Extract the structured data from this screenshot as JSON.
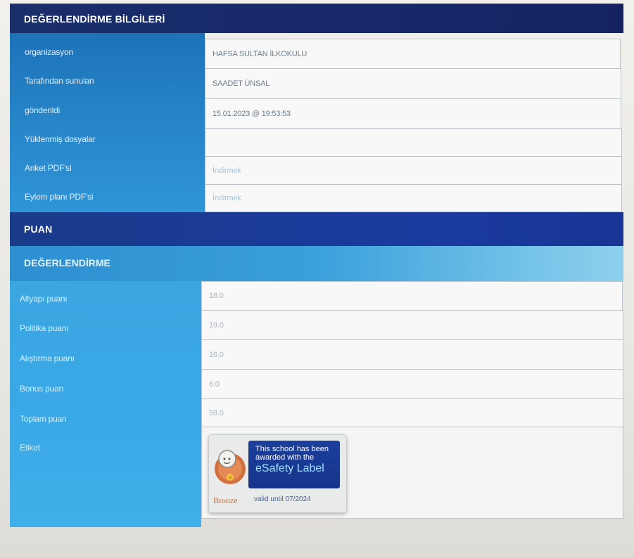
{
  "sections": {
    "info_title": "DEĞERLENDİRME BİLGİLERİ",
    "score_title": "PUAN",
    "eval_title": "DEĞERLENDİRME"
  },
  "info_rows": [
    {
      "label": "organizasyon",
      "value": "HAFSA SULTAN İLKOKULU"
    },
    {
      "label": "Tarafından sunulan",
      "value": "SAADET ÜNSAL"
    },
    {
      "label": "gönderildi",
      "value": "15.01.2023 @ 19:53:53"
    },
    {
      "label": "Yüklenmiş dosyalar",
      "value": ""
    },
    {
      "label": "Anket PDF'si",
      "value": "İndirmek"
    },
    {
      "label": "Eylem planı PDF'si",
      "value": "İndirmek"
    }
  ],
  "score_rows": [
    {
      "label": "Altyapı puanı",
      "value": "18.0"
    },
    {
      "label": "Politika puanı",
      "value": "19.0"
    },
    {
      "label": "Alıştırma puanı",
      "value": "16.0"
    },
    {
      "label": "Bonus puan",
      "value": "6.0"
    },
    {
      "label": "Toplam puan",
      "value": "59.0"
    }
  ],
  "label_row": {
    "label": "Etiket",
    "badge": {
      "line1": "This school has been",
      "line2": "awarded with the",
      "title": "eSafety Label",
      "level": "Bronze",
      "validity": "valid until 07/2024",
      "icon": "esafety-medal-icon"
    }
  },
  "colors": {
    "header_navy": "#1a2e6a",
    "left_blue": "#2a8fd4",
    "cell_bg": "#f7f8f7",
    "badge_blue": "#1b3f9c",
    "bronze": "#c76a3c"
  }
}
